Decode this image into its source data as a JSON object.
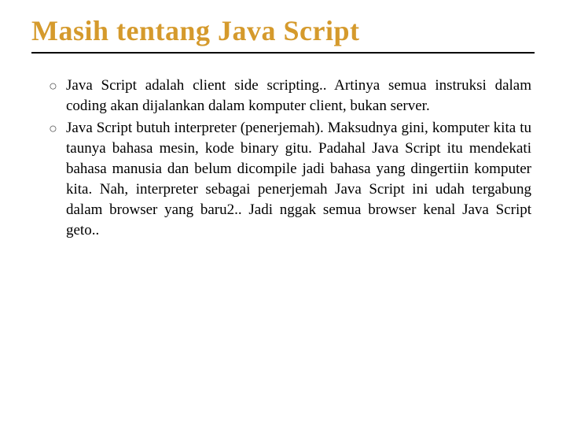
{
  "slide": {
    "title": "Masih tentang Java Script",
    "bullets": [
      "Java Script adalah client side scripting.. Artinya semua instruksi dalam coding akan dijalankan dalam komputer client, bukan server.",
      "Java Script butuh interpreter (penerjemah). Maksudnya gini, komputer kita tu taunya bahasa mesin, kode binary gitu. Padahal Java Script itu mendekati bahasa manusia dan belum dicompile jadi bahasa yang dingertiin komputer kita. Nah, interpreter sebagai penerjemah Java Script ini udah tergabung dalam browser yang baru2.. Jadi nggak semua browser kenal Java Script geto.."
    ]
  }
}
